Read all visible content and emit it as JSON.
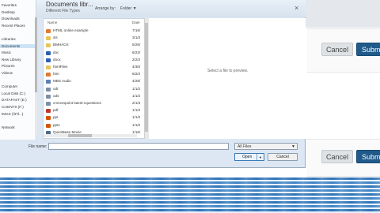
{
  "dialog": {
    "title": "Documents libr...",
    "subtitle": "Different File Types",
    "arrange_by": "Arrange by:",
    "arrange_value": "Folder",
    "nav_items": [
      "Favorites",
      "Desktop",
      "Downloads",
      "Recent Places",
      "",
      "Libraries",
      "Documents",
      "Music",
      "New Library",
      "Pictures",
      "Videos",
      "",
      "Computer",
      "Local Disk (C:)",
      "DATAFAST (E:)",
      "CLIENTS (F:)",
      "IMGS (\\\\Fil...)",
      "",
      "Network"
    ],
    "columns": {
      "name": "Name",
      "date": "Date"
    },
    "files": [
      {
        "name": "HTML online example",
        "date": "7/16/",
        "icon": "html"
      },
      {
        "name": "xls",
        "date": "3/1/2",
        "icon": "folder"
      },
      {
        "name": "BMHACK",
        "date": "5/26/",
        "icon": "folder"
      },
      {
        "name": "doc",
        "date": "6/23/",
        "icon": "word"
      },
      {
        "name": "docx",
        "date": "2/2/2",
        "icon": "word"
      },
      {
        "name": "htmlFiles",
        "date": "4/30/",
        "icon": "folder"
      },
      {
        "name": "htm",
        "date": "6/2/2",
        "icon": "html"
      },
      {
        "name": "MBS Audio",
        "date": "4/28/",
        "icon": "audio"
      },
      {
        "name": "odt",
        "date": "1/1/2",
        "icon": "doc"
      },
      {
        "name": "ods",
        "date": "1/1/2",
        "icon": "doc"
      },
      {
        "name": "cmmonpoint latest-cquestions",
        "date": "2/1/3",
        "icon": "doc"
      },
      {
        "name": "pdf",
        "date": "1/1/2",
        "icon": "pdf"
      },
      {
        "name": "ppt",
        "date": "1/1/2",
        "icon": "ppt"
      },
      {
        "name": "pptx",
        "date": "1/1/2",
        "icon": "ppt"
      },
      {
        "name": "QuickBase Movie",
        "date": "1/16/",
        "icon": "video"
      }
    ],
    "preview_text": "Select a file to preview.",
    "file_name_label": "File name:",
    "file_name_value": "",
    "file_type_value": "All Files",
    "open_label": "Open",
    "cancel_label": "Cancel"
  },
  "page": {
    "cancel_label_1": "Cancel",
    "submit_label_1": "Submit",
    "cancel_label_2": "Cancel",
    "submit_label_2": "Submit"
  },
  "colors": {
    "folder": "#e8c35a",
    "html": "#e07a2f",
    "word": "#2b5fb3",
    "doc": "#7a8fa6",
    "pdf": "#c0392b",
    "ppt": "#d35400",
    "audio": "#5a7fb0",
    "video": "#4a6b8a",
    "accent": "#1f5a8a"
  }
}
